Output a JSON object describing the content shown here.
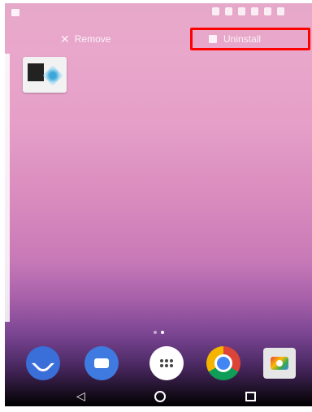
{
  "drop_targets": {
    "remove_label": "Remove",
    "uninstall_label": "Uninstall"
  },
  "highlight_color": "#ff0000",
  "home_screen": {
    "dragged_app": {
      "icon": "wifi-file-transfer-app-icon"
    },
    "page_indicator": {
      "pages": 2,
      "current": 1
    },
    "dock": [
      "phone-icon",
      "messages-icon",
      "app-drawer-icon",
      "chrome-icon",
      "camera-icon"
    ]
  },
  "navigation": [
    "back-icon",
    "home-icon",
    "recents-icon"
  ]
}
